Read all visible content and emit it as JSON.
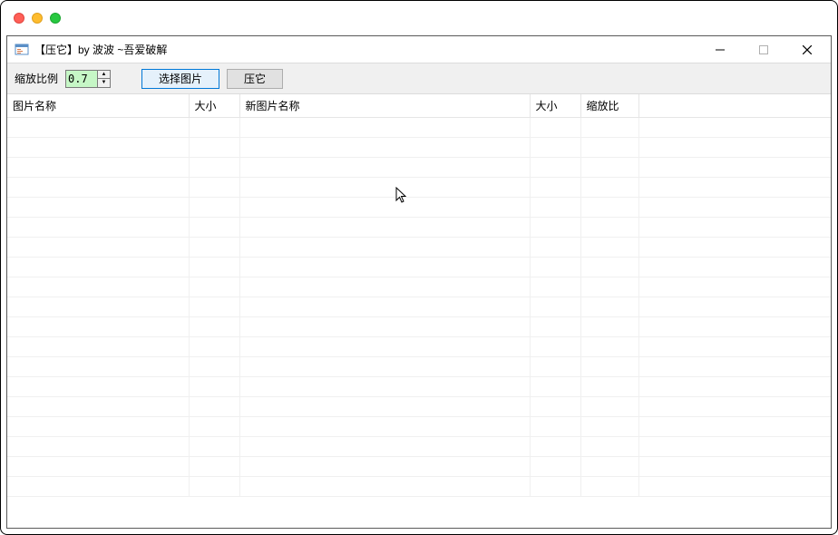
{
  "window": {
    "title": "【压它】by 波波 ~吾爱破解"
  },
  "toolbar": {
    "scale_label": "缩放比例",
    "scale_value": "0.7",
    "select_button": "选择图片",
    "compress_button": "压它"
  },
  "columns": {
    "c0": "图片名称",
    "c1": "大小",
    "c2": "新图片名称",
    "c3": "大小",
    "c4": "缩放比",
    "c5": ""
  }
}
